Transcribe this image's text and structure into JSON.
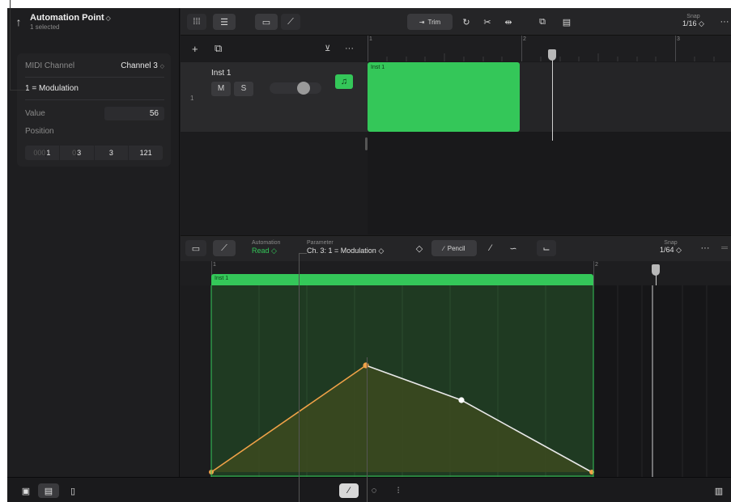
{
  "inspector": {
    "title": "Automation Point",
    "subtitle": "1 selected",
    "midi_channel_label": "MIDI Channel",
    "midi_channel_value": "Channel 3",
    "controller": "1 = Modulation",
    "value_label": "Value",
    "value": "56",
    "position_label": "Position",
    "position": {
      "prefix": "000",
      "bar": "1",
      "beat_prefix": "0",
      "beat": "3",
      "division": "3",
      "tick": "121"
    }
  },
  "toolbar": {
    "trim_label": "Trim",
    "snap_label": "Snap",
    "snap_value": "1/16"
  },
  "tracks": {
    "number": "1",
    "name": "Inst 1",
    "mute": "M",
    "solo": "S"
  },
  "arrange": {
    "ruler": [
      "1",
      "2",
      "3"
    ],
    "region_name": "Inst 1"
  },
  "automation_editor": {
    "automation_label": "Automation",
    "automation_mode": "Read",
    "parameter_label": "Parameter",
    "parameter_value": "Ch. 3: 1 = Modulation",
    "pencil_label": "Pencil",
    "snap_label": "Snap",
    "snap_value": "1/64",
    "ruler": [
      "1",
      "2"
    ],
    "region_name": "Inst 1"
  },
  "colors": {
    "accent_green": "#34c759",
    "selected_point": "#f0a248",
    "curve": "#e8e8e8"
  },
  "icons": [
    "back-arrow-icon",
    "grid-icon",
    "list-icon",
    "window-icon",
    "automation-icon",
    "trim-icon",
    "loop-icon",
    "scissors-icon",
    "split-icon",
    "copy-icon",
    "paste-icon",
    "more-icon",
    "plus-icon",
    "duplicate-icon",
    "download-icon",
    "pointer-icon",
    "brush-icon",
    "curve-icon",
    "elbow-icon",
    "pencil-icon",
    "metronome-icon",
    "mixer-icon",
    "keyboard-icon"
  ]
}
